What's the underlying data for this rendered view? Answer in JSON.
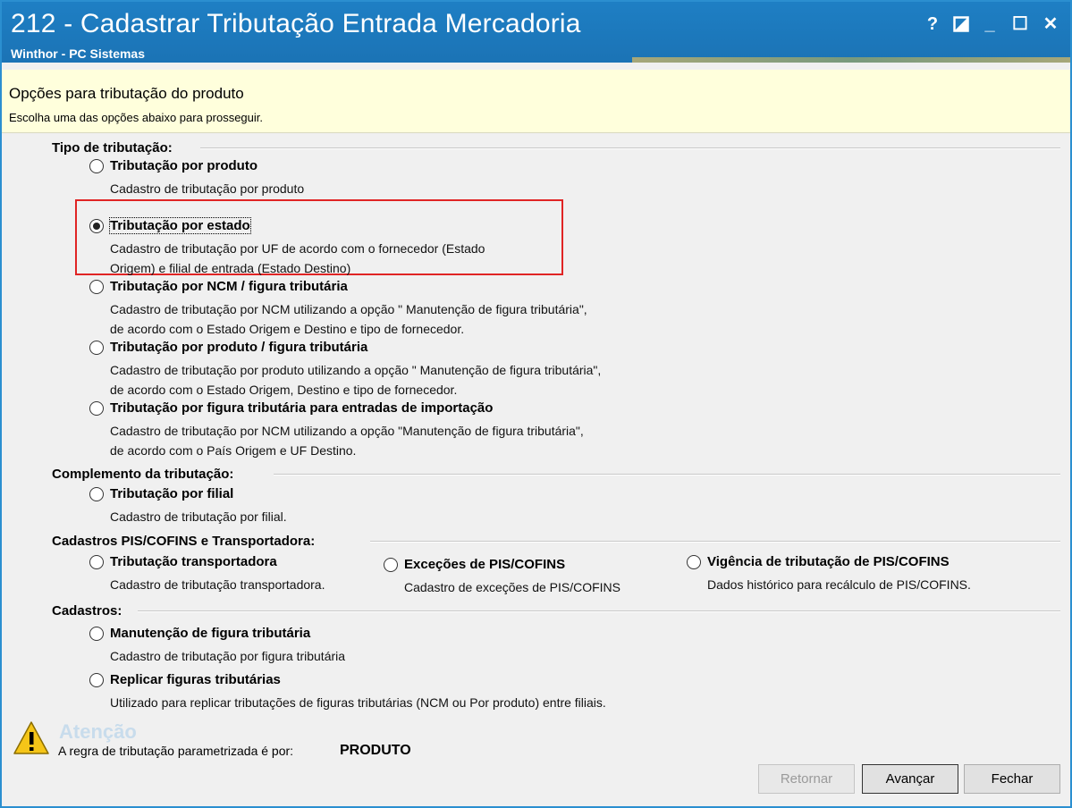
{
  "window": {
    "title": "212 - Cadastrar Tributação Entrada Mercadoria",
    "subtitle": "Winthor - PC Sistemas",
    "controls": {
      "help": "?",
      "restore_icon": "half-square-icon",
      "minimize": "_",
      "maximize": "☐",
      "close": "✕"
    }
  },
  "header": {
    "title": "Opções para tributação do produto",
    "subtitle": "Escolha uma das opções abaixo para prosseguir."
  },
  "sections": {
    "tipo": {
      "label": "Tipo de tributação:",
      "options": [
        {
          "label": "Tributação por produto",
          "desc": [
            "Cadastro de tributação por produto"
          ],
          "selected": false
        },
        {
          "label": "Tributação por estado",
          "desc": [
            "Cadastro de tributação por UF de acordo com o fornecedor (Estado",
            "Origem) e filial de entrada (Estado Destino)"
          ],
          "selected": true
        },
        {
          "label": "Tributação por NCM / figura tributária",
          "desc": [
            "Cadastro de tributação por NCM utilizando a opção \" Manutenção de figura tributária\",",
            "de acordo com o Estado Origem e Destino e tipo de fornecedor."
          ],
          "selected": false
        },
        {
          "label": "Tributação por produto / figura tributária",
          "desc": [
            "Cadastro de tributação por produto utilizando a opção \" Manutenção de figura tributária\",",
            "de acordo com o Estado Origem, Destino e tipo de fornecedor."
          ],
          "selected": false
        },
        {
          "label": "Tributação por figura tributária para entradas de importação",
          "desc": [
            "Cadastro de tributação por NCM utilizando a opção \"Manutenção de figura tributária\",",
            "de acordo com o País Origem e UF Destino."
          ],
          "selected": false
        }
      ]
    },
    "complemento": {
      "label": "Complemento da tributação:",
      "options": [
        {
          "label": "Tributação por filial",
          "desc": [
            "Cadastro de tributação por filial."
          ],
          "selected": false
        }
      ]
    },
    "pis": {
      "label": "Cadastros PIS/COFINS e Transportadora:",
      "options": [
        {
          "label": "Tributação  transportadora",
          "desc": [
            "Cadastro de tributação transportadora."
          ],
          "selected": false
        },
        {
          "label": "Exceções de PIS/COFINS",
          "desc": [
            "Cadastro de exceções de PIS/COFINS"
          ],
          "selected": false
        },
        {
          "label": "Vigência de tributação de PIS/COFINS",
          "desc": [
            "Dados histórico para recálculo de PIS/COFINS."
          ],
          "selected": false
        }
      ]
    },
    "cadastros": {
      "label": "Cadastros:",
      "options": [
        {
          "label": "Manutenção de figura tributária",
          "desc": [
            "Cadastro de tributação por figura tributária"
          ],
          "selected": false
        },
        {
          "label": "Replicar figuras tributárias",
          "desc": [
            "Utilizado para replicar tributações de figuras tributárias (NCM ou Por produto) entre filiais."
          ],
          "selected": false
        }
      ]
    }
  },
  "attention": {
    "icon": "warning-icon",
    "title": "Atenção",
    "text": "A regra de tributação parametrizada é por:",
    "value": "PRODUTO"
  },
  "buttons": {
    "back": {
      "label": "Retornar",
      "enabled": false
    },
    "next": {
      "label": "Avançar",
      "enabled": true
    },
    "close": {
      "label": "Fechar",
      "enabled": true
    }
  },
  "colors": {
    "titlebar": "#1e7fc4",
    "header_bg": "#ffffdc",
    "highlight_box": "#e02424"
  }
}
